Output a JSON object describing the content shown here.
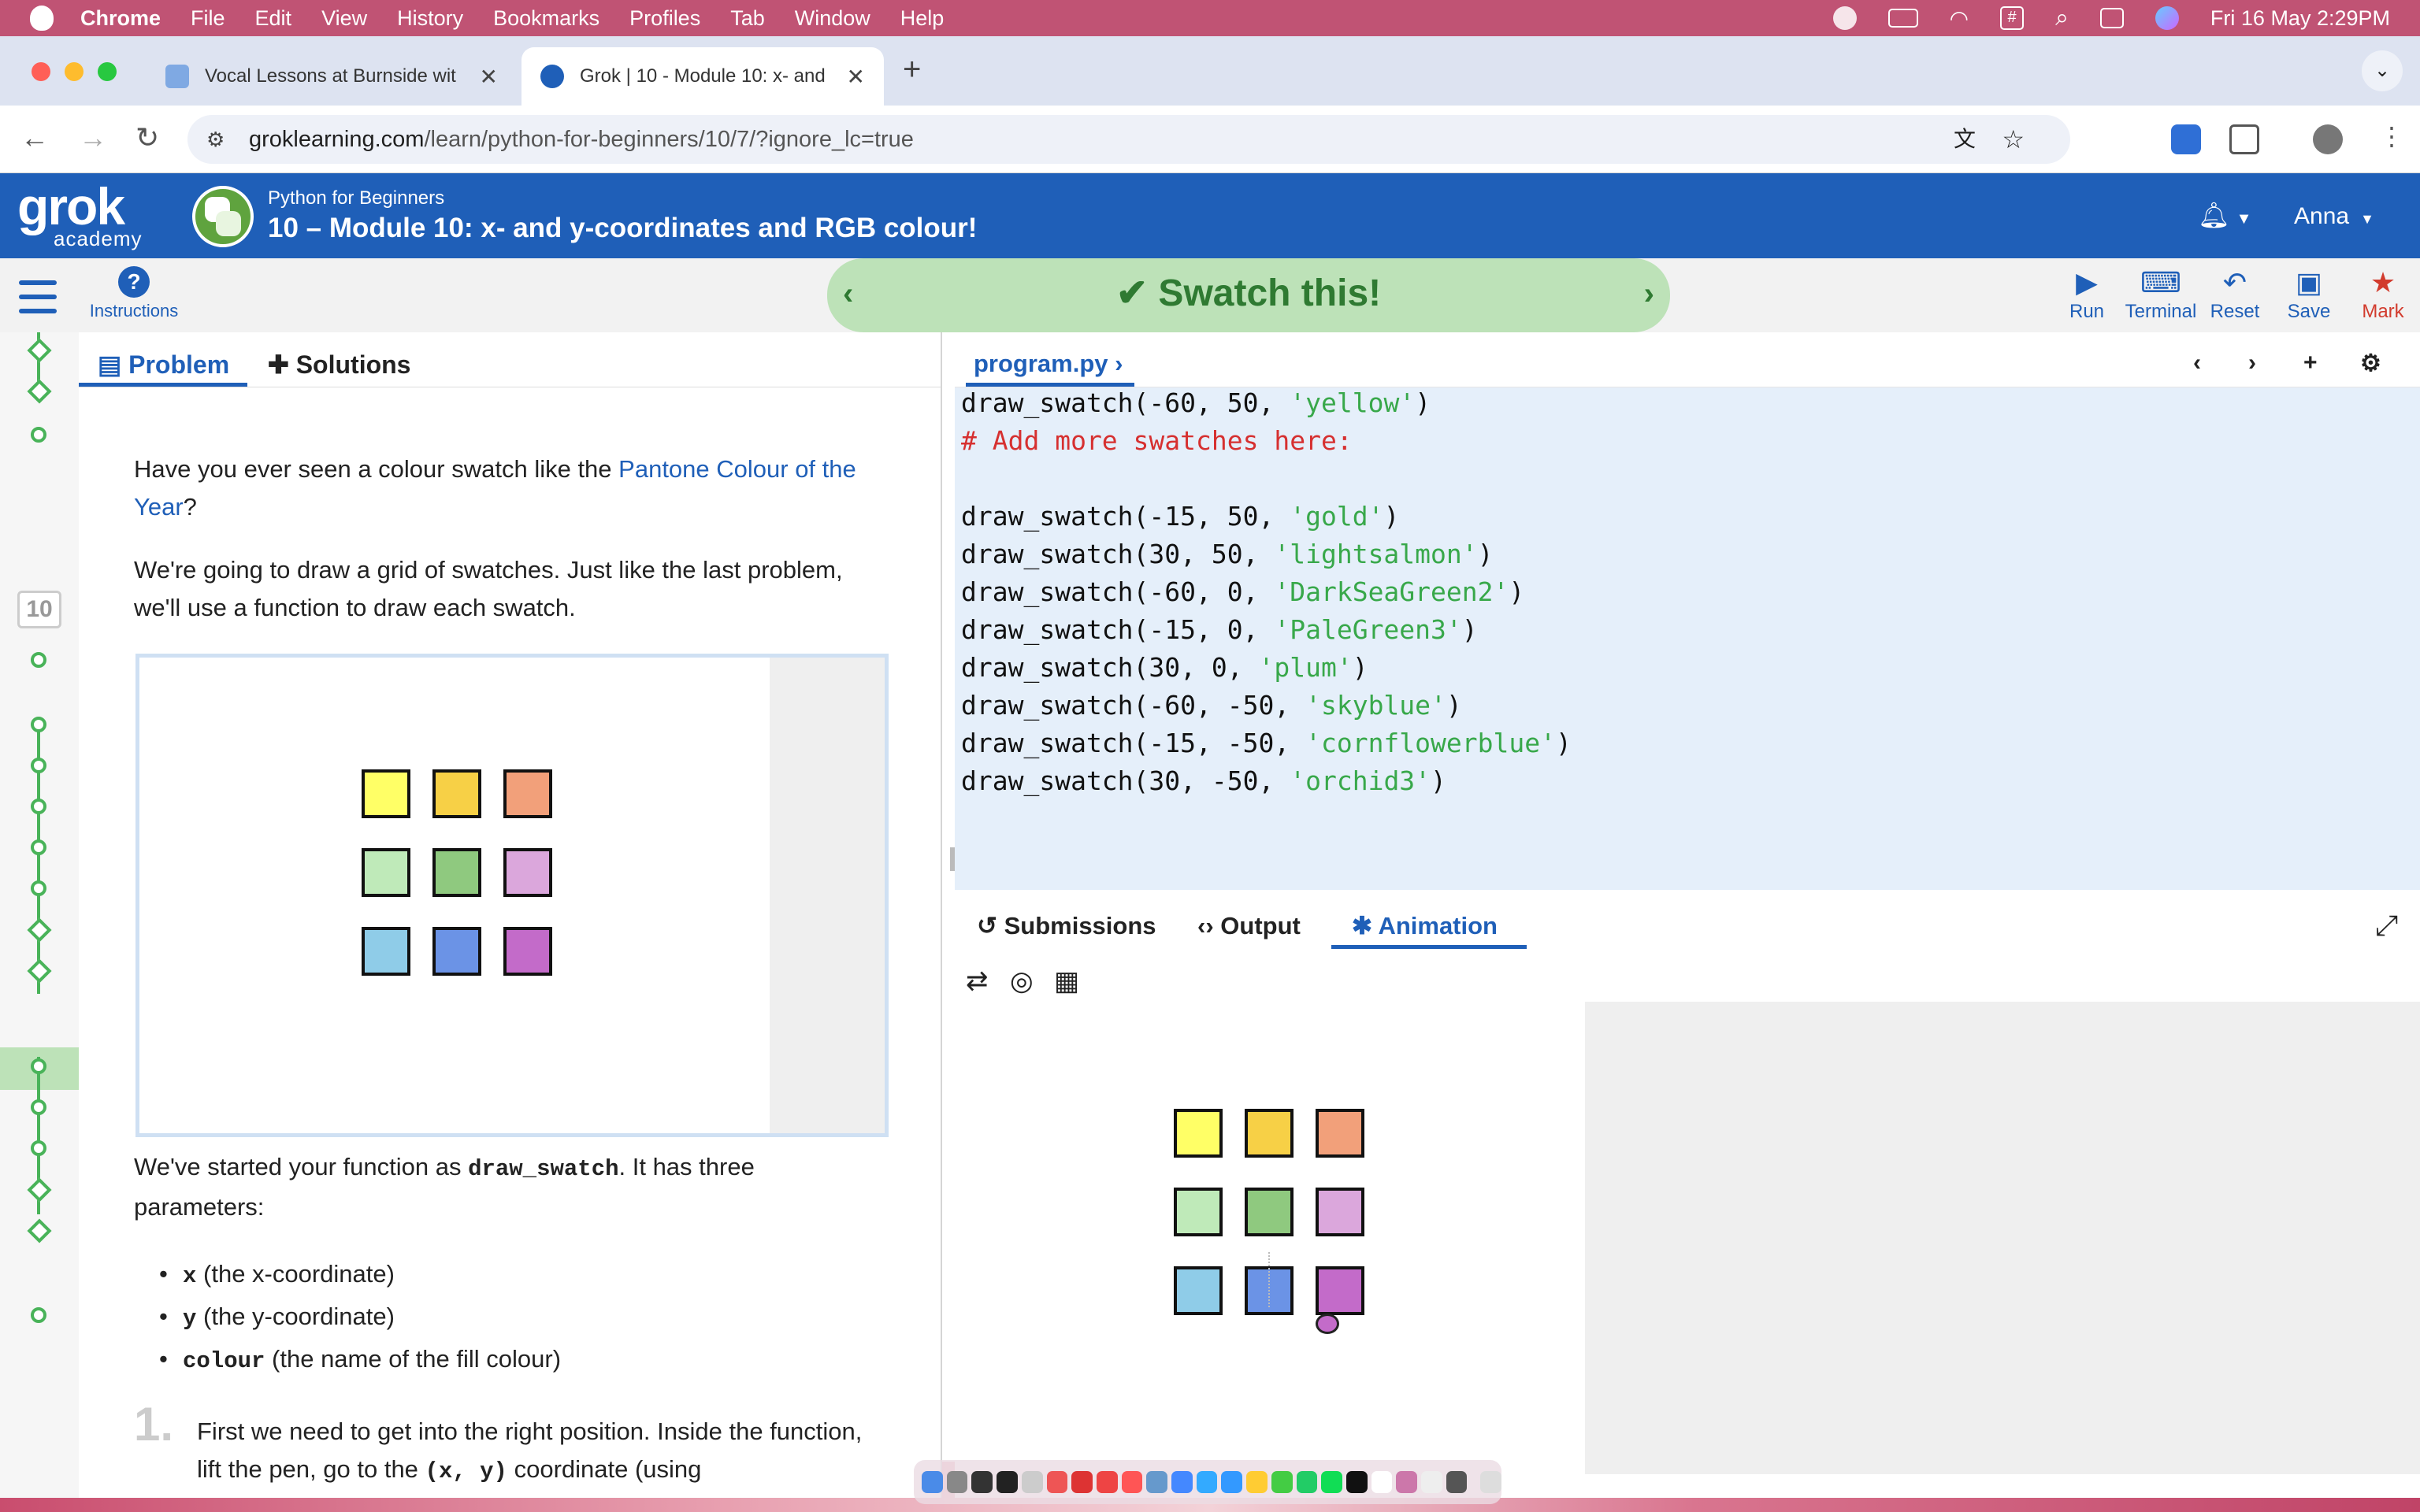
{
  "menubar": {
    "app": "Chrome",
    "items": [
      "File",
      "Edit",
      "View",
      "History",
      "Bookmarks",
      "Profiles",
      "Tab",
      "Window",
      "Help"
    ],
    "datetime": "Fri 16 May  2:29PM"
  },
  "browser": {
    "tabs": [
      {
        "title": "Vocal Lessons at Burnside wit"
      },
      {
        "title": "Grok | 10 - Module 10: x- and"
      }
    ],
    "url_host": "groklearning.com",
    "url_path": "/learn/python-for-beginners/10/7/?ignore_lc=true"
  },
  "grok": {
    "logo_main": "grok",
    "logo_sub": "academy",
    "course": "Python for Beginners",
    "module": "10 – Module 10: x- and y-coordinates and RGB colour!",
    "user": "Anna"
  },
  "lessonbar": {
    "instructions": "Instructions",
    "title": "Swatch this!",
    "actions": {
      "run": "Run",
      "terminal": "Terminal",
      "reset": "Reset",
      "save": "Save",
      "mark": "Mark"
    }
  },
  "rail": {
    "level": "10"
  },
  "problem": {
    "tab_problem": "Problem",
    "tab_solutions": "Solutions",
    "p1_a": "Have you ever seen a colour swatch like the ",
    "p1_link": "Pantone Colour of the Year",
    "p1_b": "?",
    "p2": "We're going to draw a grid of swatches. Just like the last problem, we'll use a function to draw each swatch.",
    "p3_a": "We've started your function as ",
    "p3_code": "draw_swatch",
    "p3_b": ". It has three parameters:",
    "params": [
      {
        "code": "x",
        "text": " (the x-coordinate)"
      },
      {
        "code": "y",
        "text": " (the y-coordinate)"
      },
      {
        "code": "colour",
        "text": " (the name of the fill colour)"
      }
    ],
    "step_number": "1.",
    "step_a": "First we need to get into the right position. Inside the function, lift the pen, go to the ",
    "step_code": "(x, y)",
    "step_b": " coordinate (using"
  },
  "editor": {
    "filename": "program.py",
    "lines": [
      {
        "pre": "draw_swatch(-60, 50, ",
        "str": "'yellow'",
        "post": ")"
      },
      {
        "comment": "# Add more swatches here:"
      },
      {
        "blank": true
      },
      {
        "pre": "draw_swatch(-15, 50, ",
        "str": "'gold'",
        "post": ")"
      },
      {
        "pre": "draw_swatch(30, 50, ",
        "str": "'lightsalmon'",
        "post": ")"
      },
      {
        "pre": "draw_swatch(-60, 0, ",
        "str": "'DarkSeaGreen2'",
        "post": ")"
      },
      {
        "pre": "draw_swatch(-15, 0, ",
        "str": "'PaleGreen3'",
        "post": ")"
      },
      {
        "pre": "draw_swatch(30, 0, ",
        "str": "'plum'",
        "post": ")"
      },
      {
        "pre": "draw_swatch(-60, -50, ",
        "str": "'skyblue'",
        "post": ")"
      },
      {
        "pre": "draw_swatch(-15, -50, ",
        "str": "'cornflowerblue'",
        "post": ")"
      },
      {
        "pre": "draw_swatch(30, -50, ",
        "str": "'orchid3'",
        "post": ")"
      }
    ]
  },
  "output": {
    "tab_submissions": "Submissions",
    "tab_output": "Output",
    "tab_animation": "Animation"
  },
  "swatches": [
    {
      "row": 0,
      "col": 0,
      "color": "#ffff66"
    },
    {
      "row": 0,
      "col": 1,
      "color": "#f7d046"
    },
    {
      "row": 0,
      "col": 2,
      "color": "#f2a07a"
    },
    {
      "row": 1,
      "col": 0,
      "color": "#bfeab9"
    },
    {
      "row": 1,
      "col": 1,
      "color": "#8fc97f"
    },
    {
      "row": 1,
      "col": 2,
      "color": "#dba7dc"
    },
    {
      "row": 2,
      "col": 0,
      "color": "#8fcce8"
    },
    {
      "row": 2,
      "col": 1,
      "color": "#6b93e6"
    },
    {
      "row": 2,
      "col": 2,
      "color": "#c36bc9"
    }
  ],
  "colors": {
    "accent": "#1f5fb8",
    "success": "#49b359",
    "banner": "#bde2b8",
    "mark": "#d23b2d"
  },
  "icons": [
    "apple-icon",
    "wechat-icon",
    "battery-icon",
    "wifi-icon",
    "hash-icon",
    "search-icon",
    "control-center-icon",
    "siri-icon",
    "lock-icon",
    "translate-icon",
    "star-icon",
    "extension-icon",
    "puzzle-icon",
    "profile-icon",
    "more-icon",
    "bell-icon",
    "caret-down-icon",
    "list-icon",
    "help-icon",
    "play-icon",
    "terminal-icon",
    "undo-icon",
    "save-icon",
    "star-icon",
    "document-icon",
    "puzzle-icon",
    "history-icon",
    "code-icon",
    "turtle-icon",
    "loop-icon",
    "eye-off-icon",
    "grid-icon",
    "expand-icon",
    "gear-icon"
  ]
}
